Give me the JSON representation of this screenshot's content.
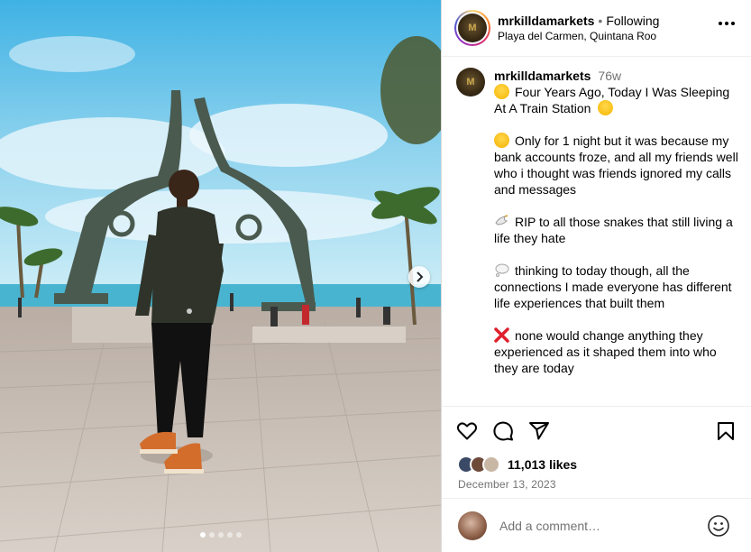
{
  "post": {
    "username": "mrkilldamarkets",
    "follow_status": "Following",
    "separator": "•",
    "location": "Playa del Carmen, Quintana Roo",
    "avatar_icon": "brand-logo-icon",
    "photo_count": 5,
    "active_photo": 1
  },
  "caption": {
    "username": "mrkilldamarkets",
    "age": "76w",
    "paragraphs": [
      {
        "emoji": "flushed-face",
        "text": "Four Years Ago, Today I Was Sleeping At A Train Station",
        "trailing_emoji": "sweat-smile-face"
      },
      {
        "emoji": "grimacing-face",
        "text": "Only for 1 night but it was because my bank accounts froze, and all my friends well who i thought was friends ignored my calls and messages"
      },
      {
        "emoji": "dove",
        "text": "RIP to all those snakes that still living a life they hate"
      },
      {
        "emoji": "thought-bubble",
        "text": "thinking to today though, all the connections I made everyone has different life experiences that built them"
      },
      {
        "emoji": "cross-mark",
        "text": "none would change anything they experienced as it shaped them into who they are today"
      }
    ]
  },
  "actions": {
    "like_icon": "heart-icon",
    "comment_icon": "comment-icon",
    "share_icon": "send-icon",
    "save_icon": "bookmark-icon"
  },
  "likes": {
    "count_text": "11,013 likes"
  },
  "date": "December 13, 2023",
  "comment": {
    "placeholder": "Add a comment…"
  },
  "colors": {
    "link_blue": "#0095f6",
    "secondary_text": "#737373",
    "sky": "#6cc3e8",
    "cross_red": "#e0202e"
  }
}
